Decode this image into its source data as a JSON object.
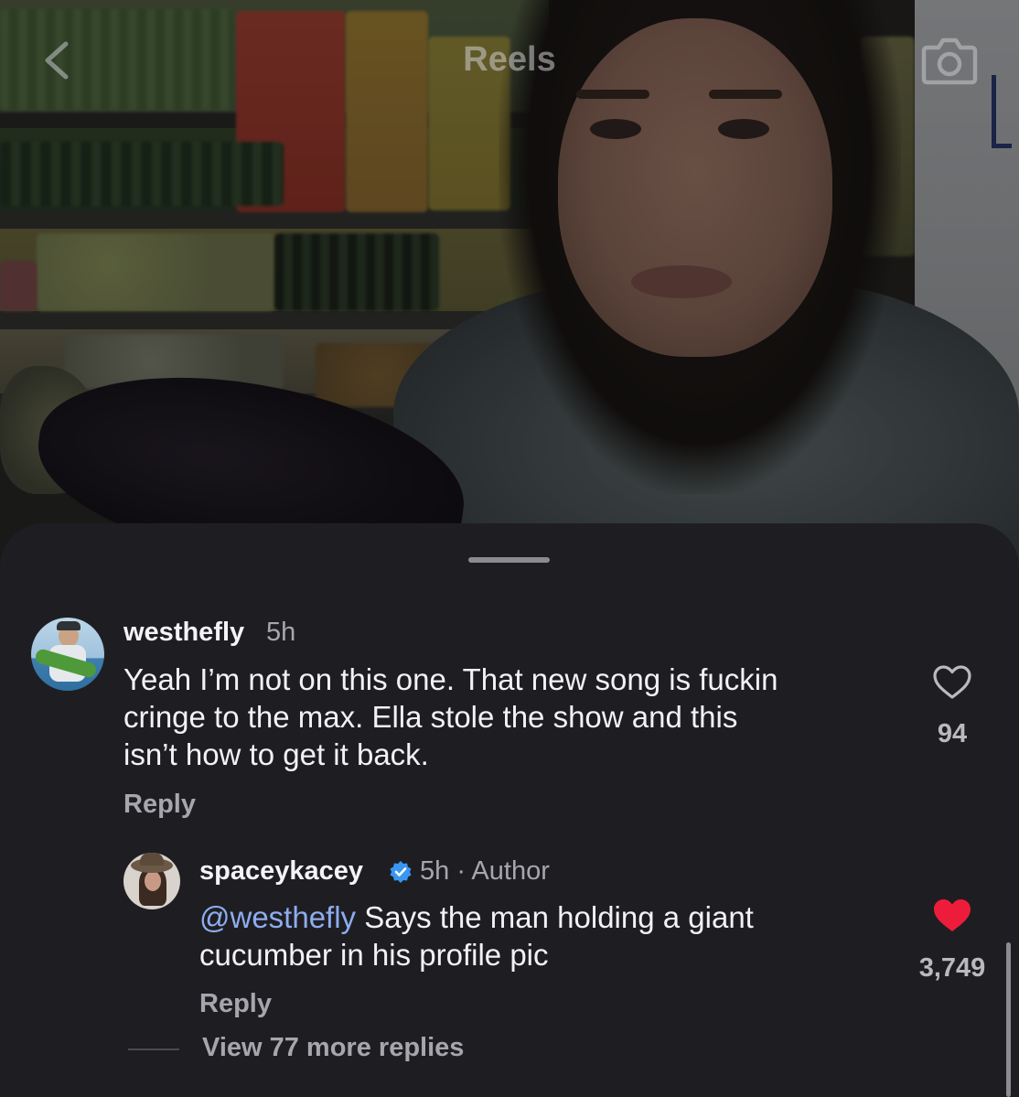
{
  "header": {
    "title": "Reels"
  },
  "icons": {
    "back": "chevron-left-icon",
    "camera": "camera-icon",
    "like": "heart-icon",
    "verified": "verified-badge-icon"
  },
  "colors": {
    "sheet_background": "#1e1e22",
    "liked_heart": "#ee1c3b",
    "mention": "#8eacf0",
    "verified_badge": "#3897f0"
  },
  "comments": [
    {
      "username": "westhefly",
      "time": "5h",
      "text_lines": [
        "Yeah I’m not on this one. That new song is fuckin",
        "cringe to the max. Ella stole the show and this",
        "isn’t how to get it back."
      ],
      "reply_label": "Reply",
      "like_count": "94",
      "liked": false
    },
    {
      "username": "spaceykacey",
      "verified": true,
      "time": "5h · Author",
      "mention": "@westhefly",
      "text_line_1": " Says the man holding a giant",
      "text_line_2": "cucumber in his profile pic",
      "reply_label": "Reply",
      "like_count": "3,749",
      "liked": true
    }
  ],
  "view_more_replies": "View 77 more replies"
}
